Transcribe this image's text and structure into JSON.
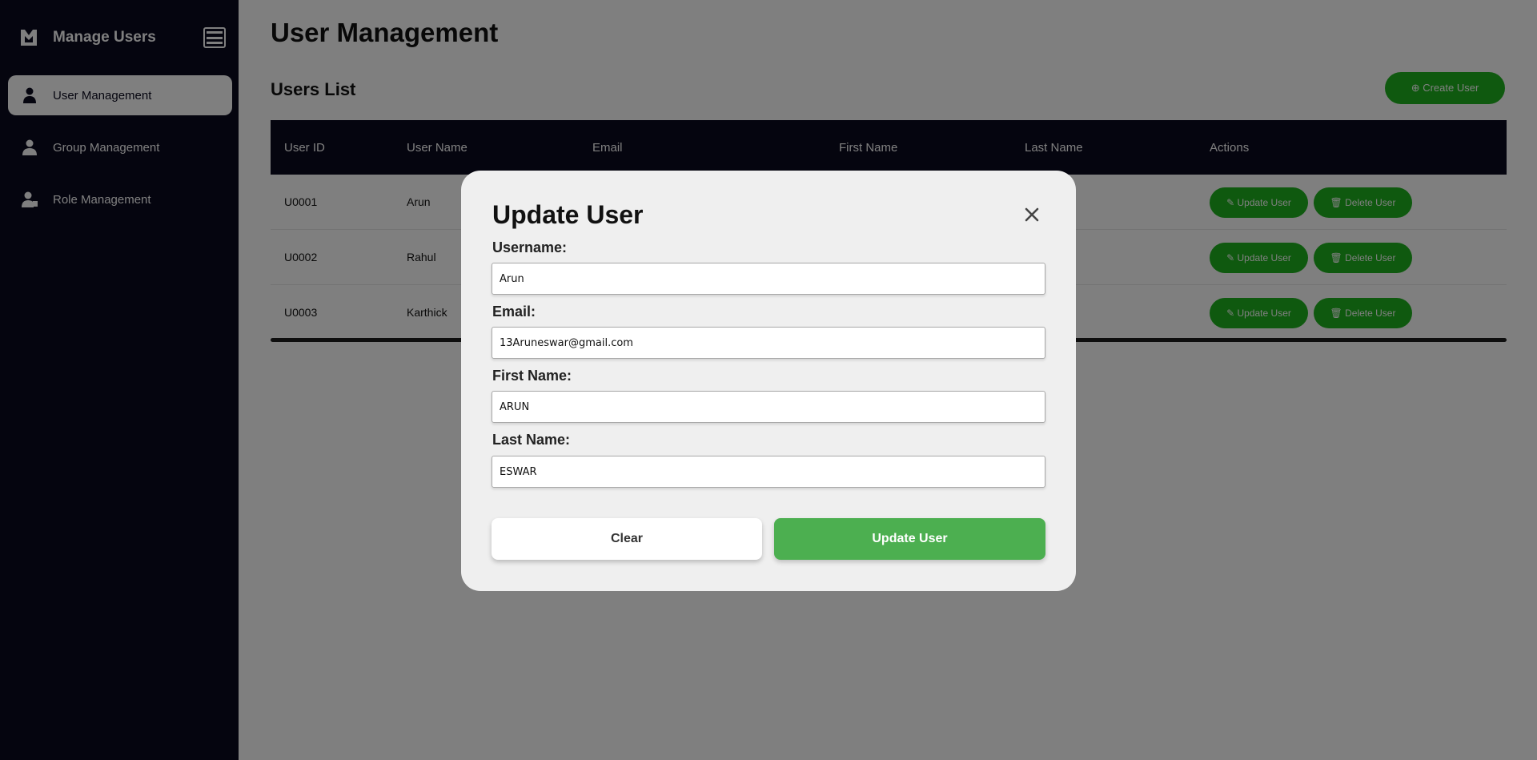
{
  "sidebar": {
    "brand": "Manage Users",
    "items": [
      {
        "label": "User Management",
        "icon": "user-icon",
        "active": true
      },
      {
        "label": "Group Management",
        "icon": "group-icon",
        "active": false
      },
      {
        "label": "Role Management",
        "icon": "role-icon",
        "active": false
      }
    ]
  },
  "main": {
    "title": "User Management",
    "list_title": "Users List",
    "create_label": "⊕ Create User",
    "columns": [
      "User ID",
      "User Name",
      "Email",
      "First Name",
      "Last Name",
      "Actions"
    ],
    "rows": [
      {
        "id": "U0001",
        "name": "Arun"
      },
      {
        "id": "U0002",
        "name": "Rahul"
      },
      {
        "id": "U0003",
        "name": "Karthick"
      }
    ],
    "update_action": "✎ Update User",
    "delete_action": "🗑 Delete User"
  },
  "modal": {
    "title": "Update User",
    "fields": {
      "username": {
        "label": "Username:",
        "value": "Arun"
      },
      "email": {
        "label": "Email:",
        "value": "13Aruneswar@gmail.com"
      },
      "first_name": {
        "label": "First Name:",
        "value": "ARUN"
      },
      "last_name": {
        "label": "Last Name:",
        "value": "ESWAR"
      }
    },
    "clear_label": "Clear",
    "update_label": "Update User"
  },
  "colors": {
    "sidebar_bg": "#0b0a1f",
    "accent_green": "#4caf50",
    "action_green": "#1fb31f",
    "modal_bg": "#efefef"
  }
}
